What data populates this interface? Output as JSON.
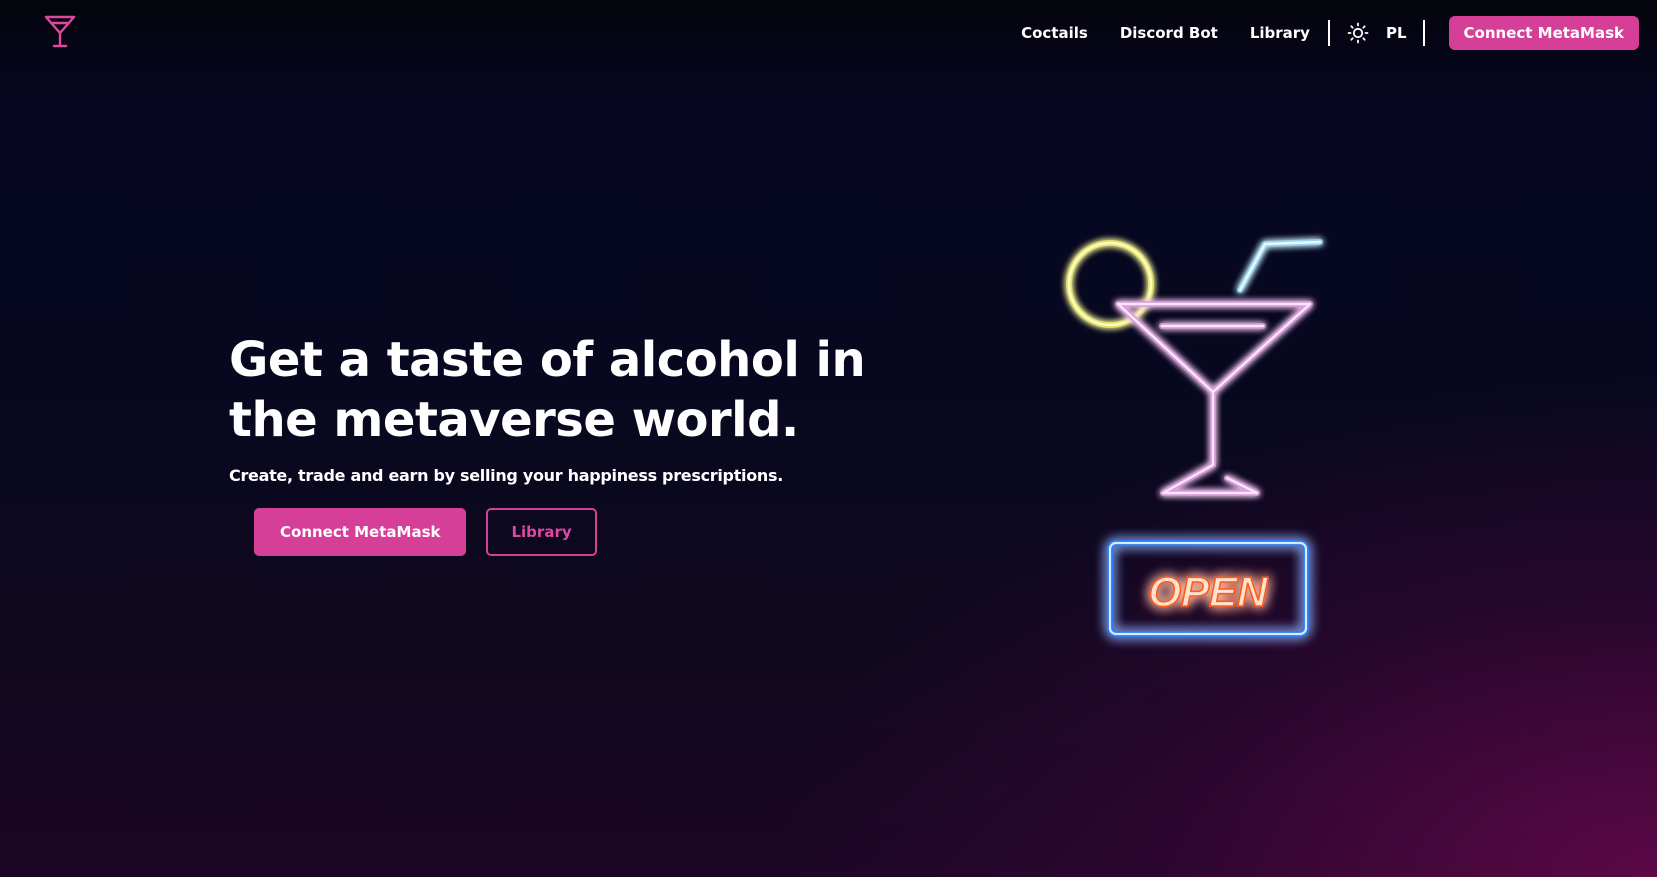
{
  "header": {
    "logo_icon": "cocktail-glass-icon",
    "nav": {
      "cocktails": "Coctails",
      "discord_bot": "Discord Bot",
      "library": "Library"
    },
    "theme_icon": "sun-icon",
    "language": "PL",
    "connect_label": "Connect MetaMask"
  },
  "hero": {
    "title": "Get a taste of alcohol in the metaverse world.",
    "subtitle": "Create, trade and earn by selling your happiness prescriptions.",
    "primary_button": "Connect MetaMask",
    "secondary_button": "Library"
  },
  "illustration": {
    "sign_text": "OPEN",
    "icon": "neon-cocktail-icon"
  },
  "colors": {
    "accent": "#d63f98",
    "background": "#07081f",
    "neon_lime": "#f4f28a",
    "neon_straw": "#bfefff",
    "neon_glass": "#ffd6ff",
    "neon_frame": "#3aa0ff",
    "neon_text": "#ff7a2e"
  }
}
